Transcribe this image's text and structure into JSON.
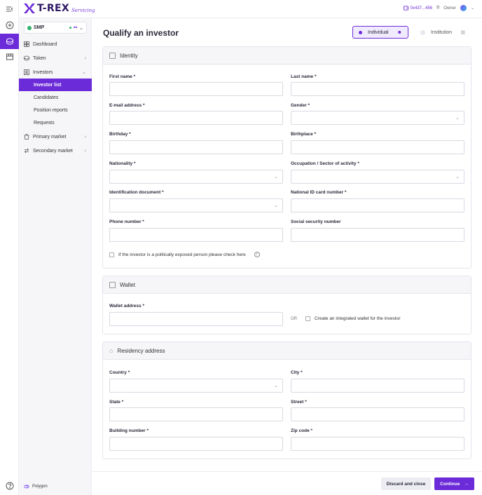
{
  "app": {
    "logo": "T-REX",
    "logo_sub": "Servicing"
  },
  "topbar": {
    "address": "0x437...456",
    "role": "Owner"
  },
  "sidebar": {
    "token": "SMP",
    "items": [
      {
        "label": "Dashboard",
        "icon": "dashboard-icon"
      },
      {
        "label": "Token",
        "icon": "token-icon"
      },
      {
        "label": "Investors",
        "icon": "investors-icon"
      },
      {
        "label": "Primary market",
        "icon": "primary-market-icon"
      },
      {
        "label": "Secondary market",
        "icon": "secondary-market-icon"
      }
    ],
    "investor_sub": [
      "Investor list",
      "Candidates",
      "Position reports",
      "Requests"
    ],
    "network": "Polygon"
  },
  "page": {
    "title": "Qualify an investor",
    "type_individual": "Individual",
    "type_institution": "Institution"
  },
  "identity": {
    "title": "Identity",
    "first_name": "First name *",
    "last_name": "Last name *",
    "email": "E-mail address *",
    "gender": "Gender *",
    "birthday": "Birthday *",
    "birthplace": "Birthplace *",
    "nationality": "Nationality *",
    "occupation": "Occupation / Sector of activity *",
    "id_document": "Identification document *",
    "national_id": "National ID card number *",
    "phone": "Phone number *",
    "ssn": "Social security number",
    "pep_check": "If the investor is a politically exposed person please check here"
  },
  "wallet": {
    "title": "Wallet",
    "wallet_address": "Wallet address *",
    "or": "OR",
    "integrated": "Create an integrated wallet for the investor"
  },
  "residency": {
    "title": "Residency address",
    "country": "Country *",
    "city": "City *",
    "state": "State *",
    "street": "Street *",
    "building": "Building number *",
    "zip": "Zip code *"
  },
  "footer": {
    "discard": "Discard and close",
    "continue": "Continue"
  },
  "colors": {
    "accent": "#6c2bd9",
    "brand_dark": "#2e1a66"
  }
}
